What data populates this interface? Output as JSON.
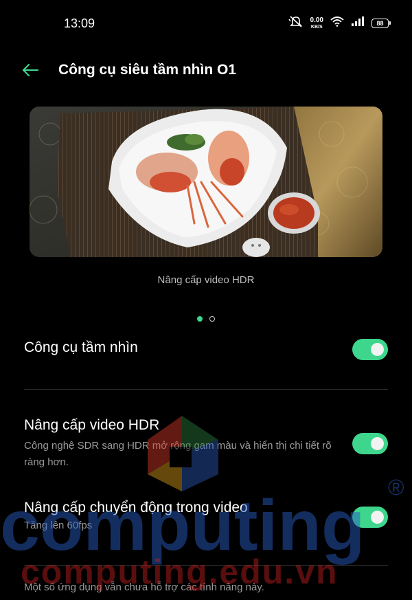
{
  "status_bar": {
    "time": "13:09",
    "net_speed_value": "0.00",
    "net_speed_unit": "KB/S",
    "battery": "88"
  },
  "header": {
    "title": "Công cụ siêu tầm nhìn O1"
  },
  "banner": {
    "caption": "Nâng cấp video HDR",
    "pages": 2,
    "active_page": 1
  },
  "settings": {
    "vision_tool": {
      "title": "Công cụ tầm nhìn",
      "enabled": true
    },
    "hdr_upgrade": {
      "title": "Nâng cấp video HDR",
      "description": "Công nghệ SDR sang HDR mở rộng gam màu và hiển thị chi tiết rõ ràng hơn.",
      "enabled": true
    },
    "motion_upgrade": {
      "title": "Nâng cấp chuyển động trong video",
      "description": "Tăng lên 60fps",
      "enabled": true
    }
  },
  "footnote": "Một số ứng dụng vẫn chưa hỗ trợ các tính năng này.",
  "watermark": {
    "word": "computing",
    "site": "computing.edu.vn",
    "mark": "®"
  },
  "colors": {
    "accent": "#3dd68c",
    "background": "#000000",
    "secondary_text": "#9a9a9a"
  }
}
